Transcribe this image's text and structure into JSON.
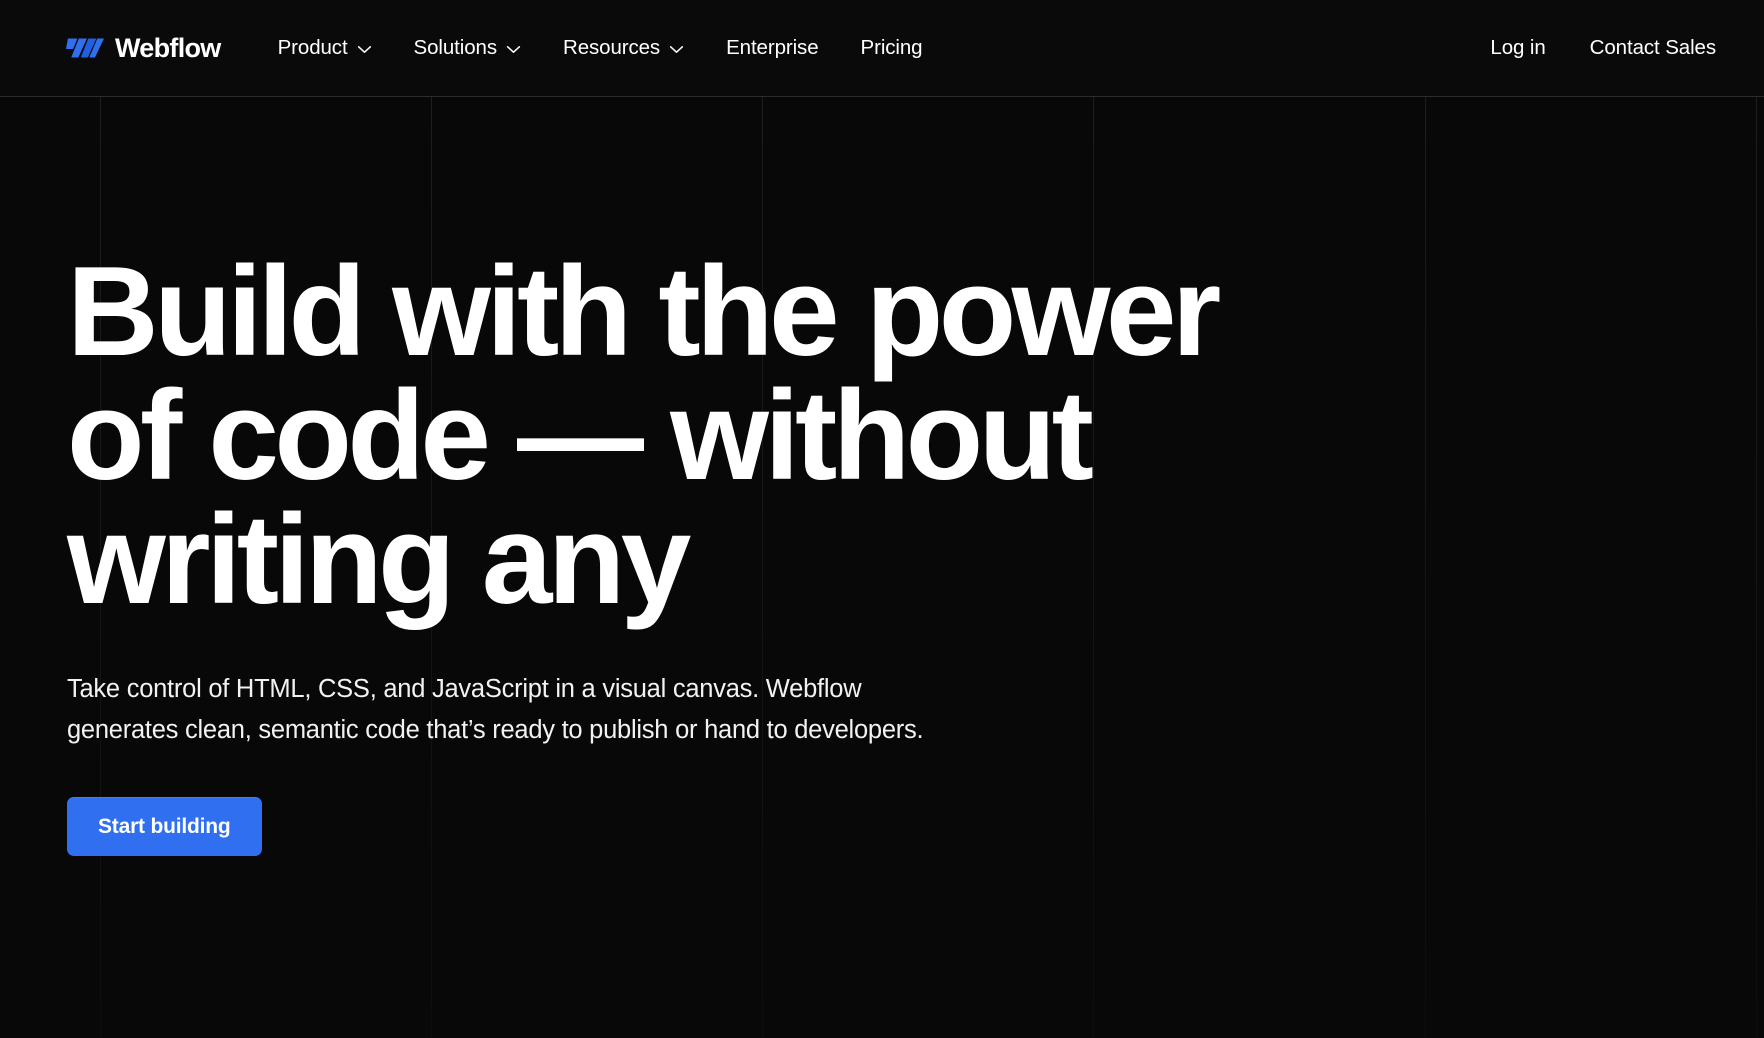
{
  "brand": {
    "name": "Webflow",
    "logo_icon": "webflow-w-logo",
    "logo_color": "#2f6ff0"
  },
  "header": {
    "nav": [
      {
        "label": "Product",
        "has_dropdown": true,
        "icon": "chevron-down-icon"
      },
      {
        "label": "Solutions",
        "has_dropdown": true,
        "icon": "chevron-down-icon"
      },
      {
        "label": "Resources",
        "has_dropdown": true,
        "icon": "chevron-down-icon"
      },
      {
        "label": "Enterprise",
        "has_dropdown": false,
        "icon": ""
      },
      {
        "label": "Pricing",
        "has_dropdown": false,
        "icon": ""
      }
    ],
    "actions": [
      {
        "label": "Log in"
      },
      {
        "label": "Contact Sales"
      }
    ]
  },
  "hero": {
    "title_lines": [
      "Build with the power",
      "of code — without",
      "writing any"
    ],
    "title_full": "Build with the power of code — without writing any",
    "subtitle_lines": [
      "Take control of HTML, CSS, and JavaScript in a visual canvas. Webflow",
      "generates clean, semantic code that’s ready to publish or hand to developers."
    ],
    "cta_label": "Start building",
    "cta_color": "#2f6ff0"
  },
  "theme": {
    "background": "#080808",
    "header_background": "#0a0a0a",
    "text": "#ffffff",
    "accent": "#2f6ff0",
    "grid_line": "rgba(255,255,255,0.08)"
  },
  "background": {
    "grid_line_positions": [
      100,
      431,
      762,
      1093,
      1425,
      1756
    ]
  }
}
